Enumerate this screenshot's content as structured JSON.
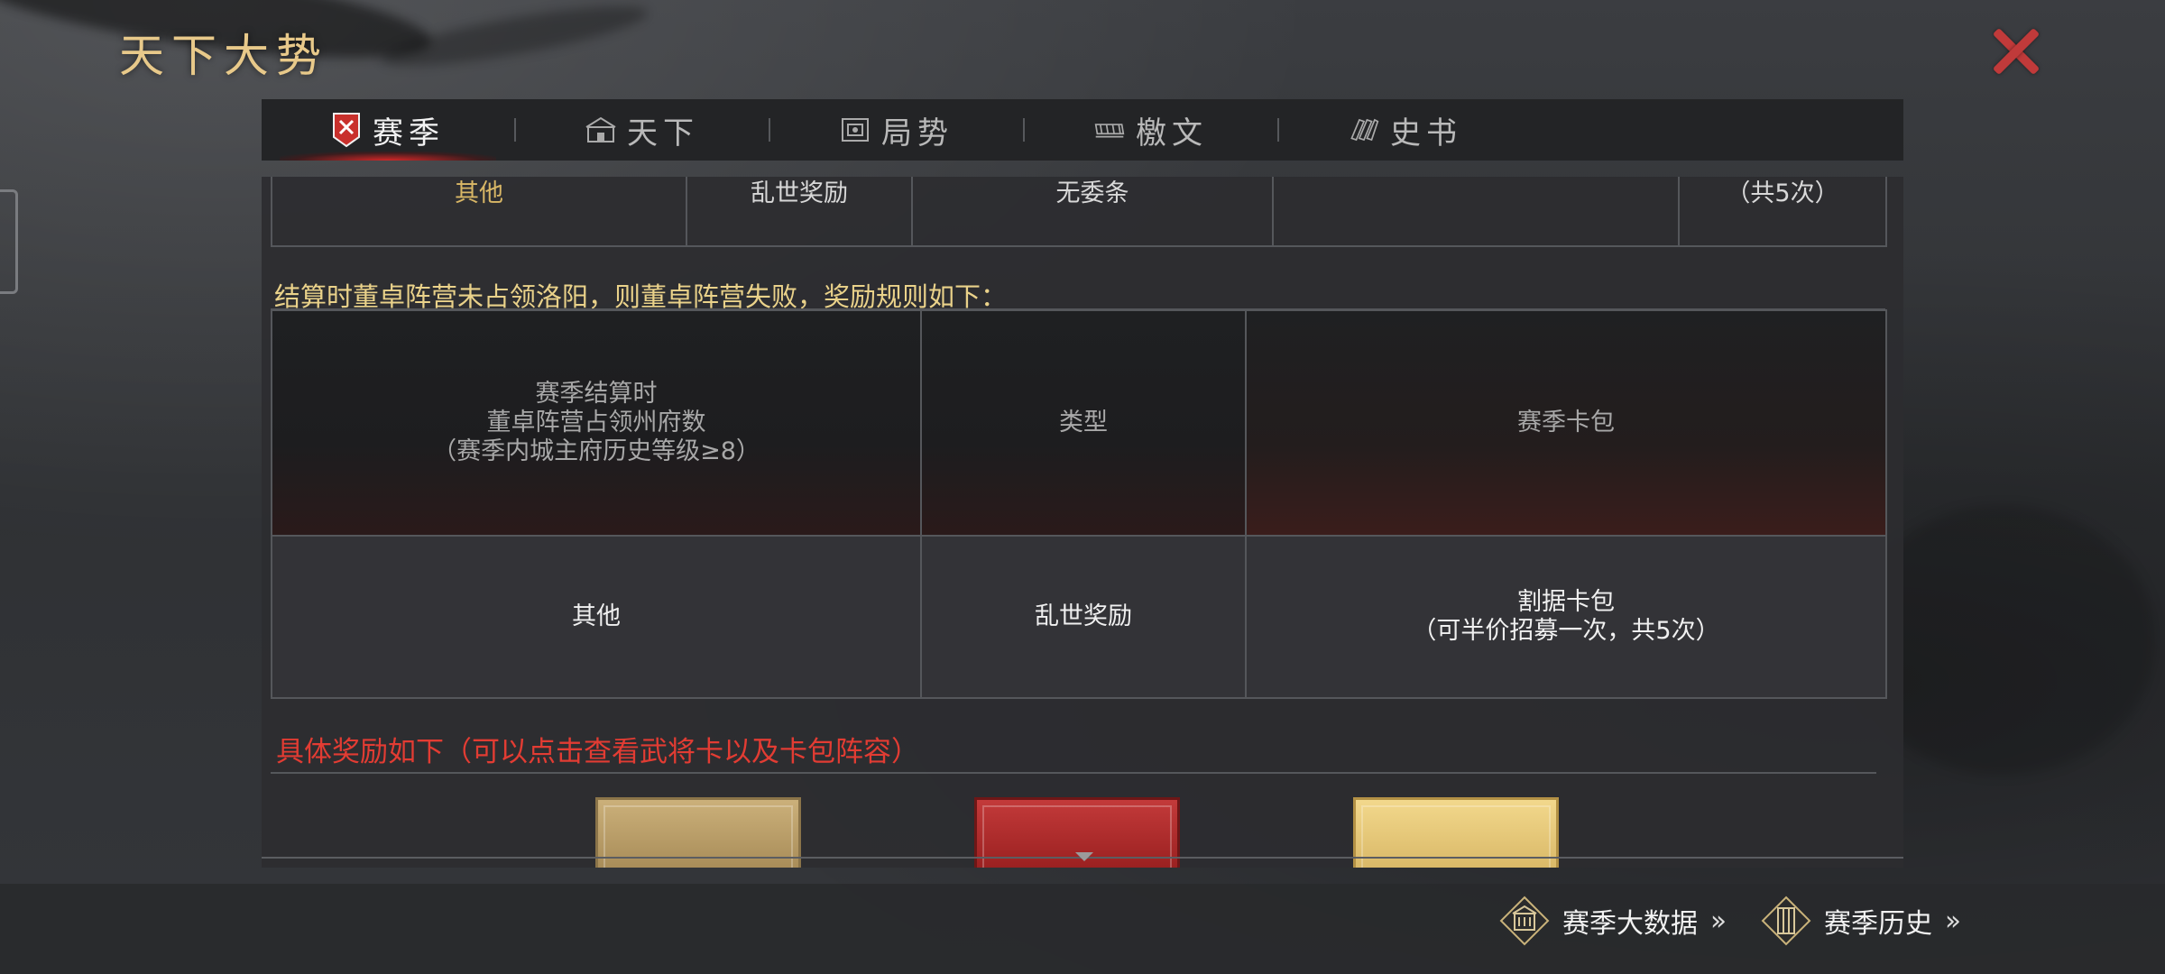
{
  "window": {
    "title": "天下大势",
    "close_icon": "close-x-icon"
  },
  "tabs": [
    {
      "label": "赛季",
      "icon": "season-banner-icon",
      "active": true
    },
    {
      "label": "天下",
      "icon": "city-gate-icon",
      "active": false
    },
    {
      "label": "局势",
      "icon": "scroll-frame-icon",
      "active": false
    },
    {
      "label": "檄文",
      "icon": "bamboo-slips-icon",
      "active": false
    },
    {
      "label": "史书",
      "icon": "books-icon",
      "active": false
    }
  ],
  "top_table": {
    "cells": [
      "其他",
      "乱世奖励",
      "无委条",
      "",
      "（共5次）"
    ]
  },
  "rule_text": "结算时董卓阵营未占领洛阳，则董卓阵营失败，奖励规则如下：",
  "main_table": {
    "headers": [
      [
        "赛季结算时",
        "董卓阵营占领州府数",
        "（赛季内城主府历史等级≥8）"
      ],
      [
        "类型"
      ],
      [
        "赛季卡包"
      ]
    ],
    "rows": [
      [
        [
          "其他"
        ],
        [
          "乱世奖励"
        ],
        [
          "割据卡包",
          "（可半价招募一次，共5次）"
        ]
      ]
    ]
  },
  "reward_note": "具体奖励如下（可以点击查看武将卡以及卡包阵容）",
  "cards": [
    "gold-card-pack",
    "red-card-pack",
    "yellow-card-pack"
  ],
  "bottom_links": {
    "season_data": {
      "label": "赛季大数据",
      "icon": "stats-building-icon"
    },
    "season_history": {
      "label": "赛季历史",
      "icon": "history-scroll-icon"
    }
  },
  "colors": {
    "title_gold": "#e8c98a",
    "rule_gold": "#ead28a",
    "note_red": "#e23c33",
    "close_red": "#c03a3a",
    "active_tab_glow": "#dc2828"
  }
}
